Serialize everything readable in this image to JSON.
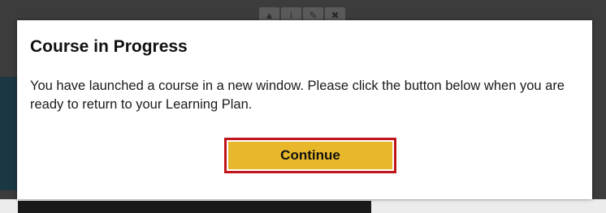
{
  "background": {
    "toolbar_icons": [
      "up-arrow-icon",
      "info-icon",
      "edit-icon",
      "close-icon"
    ],
    "toolbar_glyphs": [
      "▲",
      "i",
      "✎",
      "✖"
    ]
  },
  "dialog": {
    "title": "Course in Progress",
    "message": "You have launched a course in a new window. Please click the button below when you are ready to return to your Learning Plan.",
    "continue_label": "Continue"
  },
  "colors": {
    "button_fill": "#e8b82a",
    "button_highlight_border": "#c0161b",
    "overlay": "#3c3c3c"
  }
}
